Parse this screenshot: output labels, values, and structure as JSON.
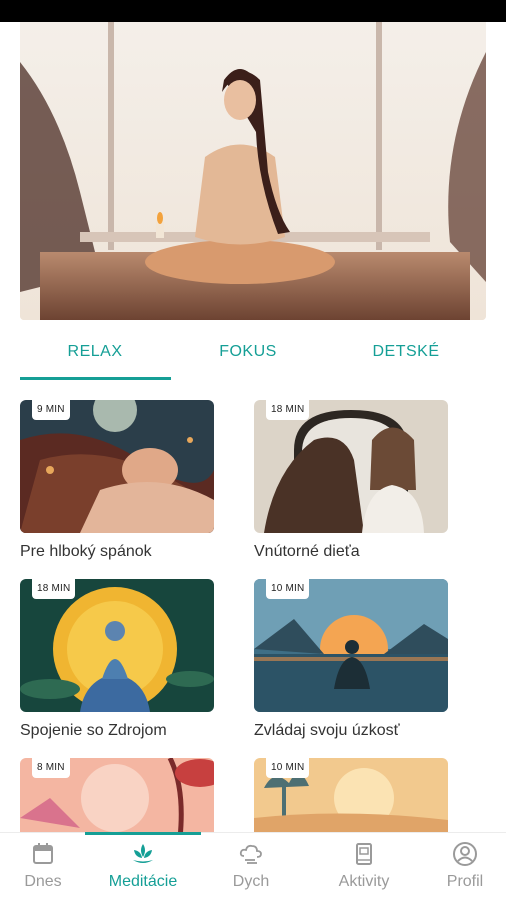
{
  "tabs": {
    "items": [
      {
        "label": "RELAX",
        "active": true
      },
      {
        "label": "FOKUS",
        "active": false
      },
      {
        "label": "DETSKÉ",
        "active": false
      }
    ]
  },
  "cards": [
    {
      "duration": "9 MIN",
      "title": "Pre hlboký spánok"
    },
    {
      "duration": "18 MIN",
      "title": "Vnútorné dieťa"
    },
    {
      "duration": "18 MIN",
      "title": "Spojenie so Zdrojom"
    },
    {
      "duration": "10 MIN",
      "title": "Zvládaj svoju úzkosť"
    },
    {
      "duration": "8 MIN",
      "title": ""
    },
    {
      "duration": "10 MIN",
      "title": ""
    }
  ],
  "bottom_nav": {
    "items": [
      {
        "label": "Dnes",
        "icon": "calendar-icon",
        "active": false
      },
      {
        "label": "Meditácie",
        "icon": "lotus-icon",
        "active": true
      },
      {
        "label": "Dych",
        "icon": "wind-cloud-icon",
        "active": false
      },
      {
        "label": "Aktivity",
        "icon": "book-icon",
        "active": false
      },
      {
        "label": "Profil",
        "icon": "user-icon",
        "active": false
      }
    ]
  },
  "colors": {
    "accent": "#159f96",
    "inactive": "#9a9a9a",
    "status_bar": "#000000"
  }
}
